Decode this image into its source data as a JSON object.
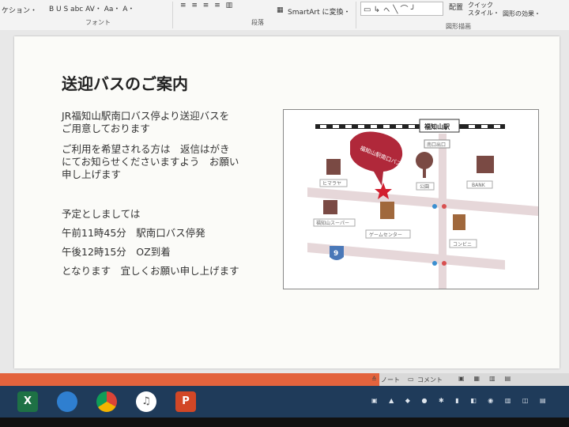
{
  "ribbon": {
    "top_left": "ケション・",
    "format_buttons": "B  U  S  abc  AV・ Aa・ A・",
    "font_group": "フォント",
    "paragraph_group": "段落",
    "smartart_button": "SmartArt に変換・",
    "arrange_label": "配置",
    "quick_style_label": "クイック スタイル・",
    "shape_effect_label": "図形の効果・",
    "drawing_group": "図形描画"
  },
  "slide": {
    "title": "送迎バスのご案内",
    "line1": "JR福知山駅南口バス停より送迎バスを",
    "line2": "ご用意しております",
    "line3": "ご利用を希望される方は　返信はがき",
    "line4": "にてお知らせくださいますよう　お願い",
    "line5": "申し上げます",
    "schedule_intro": "予定としましては",
    "schedule_1": "午前11時45分　駅南口バス停発",
    "schedule_2": "午後12時15分　OZ到着",
    "closing": "となります　宜しくお願い申し上げます"
  },
  "map": {
    "station": "福知山駅",
    "south_exit": "南口出口",
    "bus_stop_balloon": "福知山駅南口バス停",
    "park": "公園",
    "bank": "BANK",
    "building1": "ヒマラヤ",
    "supermarket": "福知山スーパー",
    "building2": "ゲームセンター",
    "convenience": "コンビニ",
    "route_number": "9",
    "colors": {
      "road": "#e6d7d9",
      "balloon": "#b0283a",
      "building": "#7a4a44",
      "star": "#d21f2f",
      "route_sign": "#4a78b8"
    }
  },
  "statusbar": {
    "notes": "ノート",
    "comments": "コメント"
  },
  "taskbar": {
    "excel_icon": "X",
    "powerpoint_icon": "P",
    "apps": [
      "excel-icon",
      "photos-icon",
      "chrome-icon",
      "itunes-icon",
      "powerpoint-icon"
    ]
  }
}
